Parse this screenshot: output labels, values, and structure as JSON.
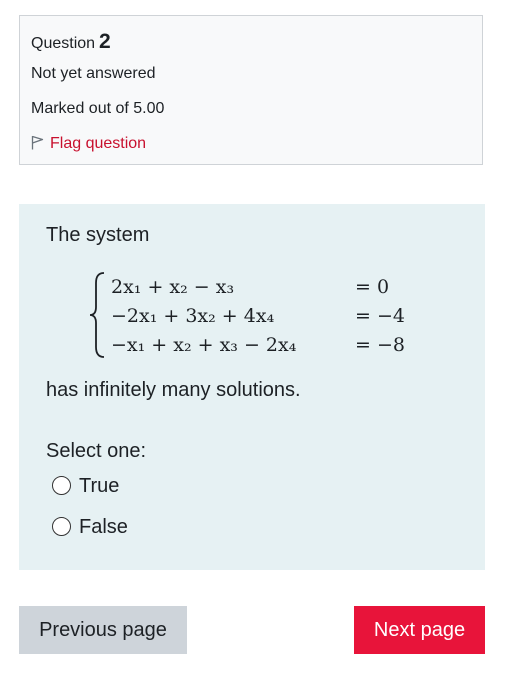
{
  "info": {
    "question_label": "Question",
    "question_number": "2",
    "state": "Not yet answered",
    "grade": "Marked out of 5.00",
    "flag_label": "Flag question"
  },
  "question": {
    "intro": "The system",
    "equations": [
      {
        "lhs": "2x₁ + x₂ − x₃",
        "rhs": "= 0"
      },
      {
        "lhs": "−2x₁ + 3x₂ + 4x₄",
        "rhs": "= −4"
      },
      {
        "lhs": "−x₁ + x₂ + x₃ − 2x₄",
        "rhs": "= −8"
      }
    ],
    "outro": "has infinitely many solutions.",
    "prompt": "Select one:",
    "options": [
      {
        "label": "True",
        "selected": false
      },
      {
        "label": "False",
        "selected": false
      }
    ]
  },
  "nav": {
    "previous_label": "Previous page",
    "next_label": "Next page"
  },
  "colors": {
    "accent": "#e8143a",
    "flag_text": "#c8102e",
    "question_bg": "#e6f1f3",
    "info_bg": "#f8f9fa"
  }
}
